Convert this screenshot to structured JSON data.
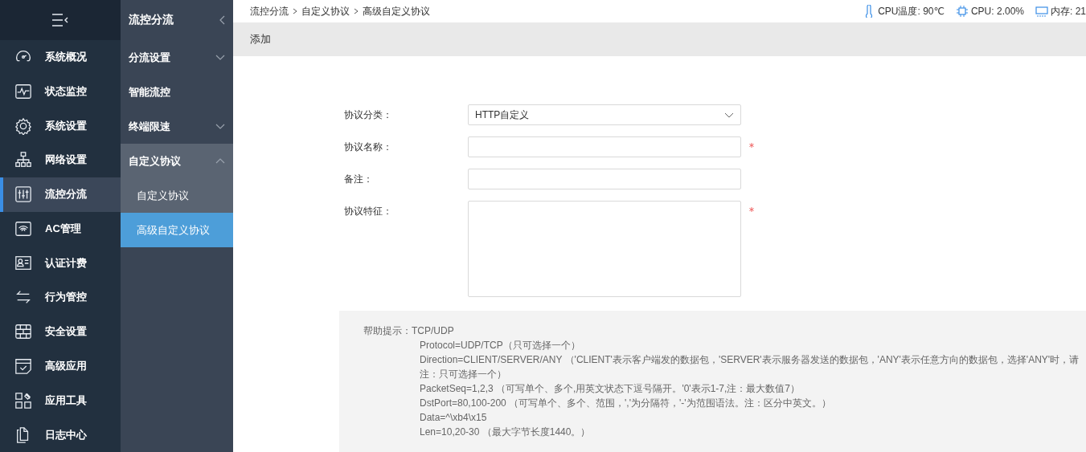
{
  "nav": {
    "items": [
      {
        "label": "系统概况",
        "selected": false
      },
      {
        "label": "状态监控",
        "selected": false
      },
      {
        "label": "系统设置",
        "selected": false
      },
      {
        "label": "网络设置",
        "selected": false
      },
      {
        "label": "流控分流",
        "selected": true
      },
      {
        "label": "AC管理",
        "selected": false
      },
      {
        "label": "认证计费",
        "selected": false
      },
      {
        "label": "行为管控",
        "selected": false
      },
      {
        "label": "安全设置",
        "selected": false
      },
      {
        "label": "高级应用",
        "selected": false
      },
      {
        "label": "应用工具",
        "selected": false
      },
      {
        "label": "日志中心",
        "selected": false
      }
    ]
  },
  "subnav": {
    "title": "流控分流",
    "items": [
      {
        "label": "分流设置",
        "kind": "group",
        "expanded": false,
        "selected": false
      },
      {
        "label": "智能流控",
        "kind": "link",
        "selected": false
      },
      {
        "label": "终端限速",
        "kind": "group",
        "expanded": false,
        "selected": false
      },
      {
        "label": "自定义协议",
        "kind": "group",
        "expanded": true,
        "selected": false,
        "children": [
          {
            "label": "自定义协议",
            "selected": false
          },
          {
            "label": "高级自定义协议",
            "selected": true
          }
        ]
      }
    ]
  },
  "breadcrumb": [
    "流控分流",
    "自定义协议",
    "高级自定义协议"
  ],
  "status": [
    {
      "kind": "temp",
      "text": "CPU温度: 90℃"
    },
    {
      "kind": "cpu",
      "text": "CPU: 2.00%"
    },
    {
      "kind": "mem",
      "text": "内存: 21"
    }
  ],
  "section_title": "添加",
  "form": [
    {
      "label": "协议分类：",
      "kind": "select",
      "value": "HTTP自定义",
      "required": false
    },
    {
      "label": "协议名称：",
      "kind": "input",
      "required": true
    },
    {
      "label": "备注：",
      "kind": "input",
      "required": false
    },
    {
      "label": "协议特征：",
      "kind": "textarea",
      "required": true
    }
  ],
  "help": {
    "title": "帮助提示：",
    "first": "TCP/UDP",
    "lines": [
      "Protocol=UDP/TCP（只可选择一个）",
      "Direction=CLIENT/SERVER/ANY （'CLIENT'表示客户端发的数据包，'SERVER'表示服务器发送的数据包，'ANY'表示任意方向的数据包，选择'ANY'时，请",
      "注：只可选择一个）",
      "PacketSeq=1,2,3 （可写单个、多个,用英文状态下逗号隔开。'0'表示1-7,注：最大数值7）",
      "DstPort=80,100-200 （可写单个、多个、范围，','为分隔符，'-'为范围语法。注：区分中英文。）",
      "Data=^\\xb4\\x15",
      "Len=10,20-30 （最大字节长度1440。）"
    ]
  }
}
